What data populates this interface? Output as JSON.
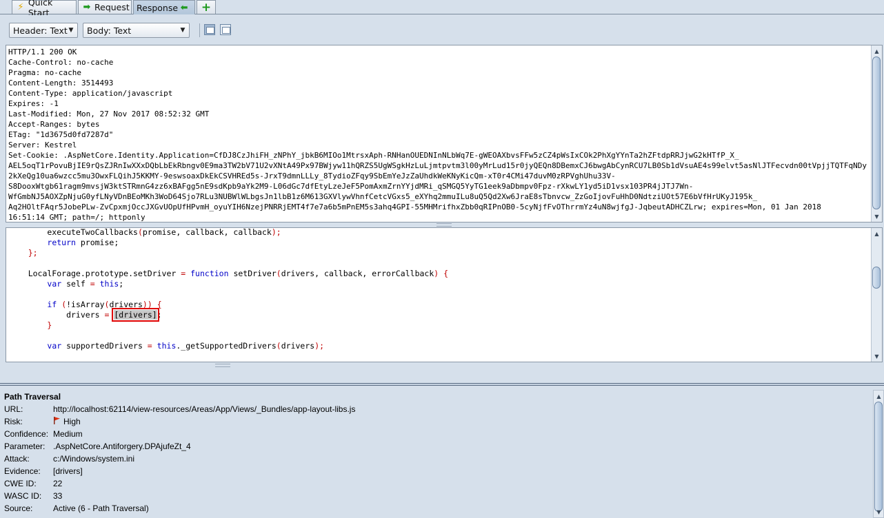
{
  "tabs": [
    {
      "label": "Quick Start",
      "icon": "lightning-icon"
    },
    {
      "label": "Request",
      "icon": "arrow-right-icon"
    },
    {
      "label": "Response",
      "icon": "arrow-left-icon"
    },
    {
      "label": "",
      "icon": "plus-icon"
    }
  ],
  "toolbar": {
    "header_view": "Header: Text",
    "body_view": "Body: Text"
  },
  "header_text": "HTTP/1.1 200 OK\nCache-Control: no-cache\nPragma: no-cache\nContent-Length: 3514493\nContent-Type: application/javascript\nExpires: -1\nLast-Modified: Mon, 27 Nov 2017 08:52:32 GMT\nAccept-Ranges: bytes\nETag: \"1d3675d0fd7287d\"\nServer: Kestrel\nSet-Cookie: .AspNetCore.Identity.Application=CfDJ8CzJhiFH_zNPhY_jbkB6MIOo1MtrsxAph-RNHanOUEDNInNLbWq7E-gWEOAXbvsFFw5zCZ4pWsIxCOk2PhXgYYnTa2hZFtdpRRJjwG2kHTfP_X_\nAEL5oqT1rPovuBjIE9rQsZJRnIwXXxDQbLbEkRbngv0E9ma3TW2bV71U2vXNtA49Px97BWjyw11hQRZS5UgWSgkHzLuLjmtpvtm3l00yMrLud15r0jyQEQn8DBemxCJ6bwgAbCynRCU7LB0Sb1dVsuAE4s99elvt5asNlJTFecvdn00tVpjjTQTFqNDy2kXeQg10ua6wzcc5mu3OwxFLQihJ5KKMY-9eswsoaxDkEkCSVHREd5s-JrxT9dmnLLLy_8TydioZFqy9SbEmYeJzZaUhdkWeKNyKicQm-xT0r4CMi47duvM0zRPVghUhu33V-\nS8DooxWtgb61ragm9mvsjW3ktSTRmnG4zz6xBAFgg5nE9sdKpb9aYk2M9-L06dGc7dfEtyLzeJeF5PomAxmZrnYYjdMRi_qSMGQ5YyTG1eek9aDbmpv0Fpz-rXkwLY1yd5iD1vsx103PR4jJTJ7Wn-\nWfGmbNJ5AOXZpNjuG0yfLNyVDnBEoMKh3WoD64Sjo7RLu3NUBWlWLbgsJn1lbB1z6M613GXVlywVhnfCetcVGxs5_eXYhq2mmuILu8uQ5Qd2Xw6JraE8sTbnvcw_ZzGoIjovFuHhD0NdtziUOt57E6bVfHrUKyJ195k_\nAq2HOltFAqr5JobePLw-ZvCpxmjOccJXGvUOpUfHPvmH_oyuYIH6NzejPNRRjEMT4f7e7a6b5mPnEM5s3ahq4GPI-55MHMrifhxZbb0qRIPnOB0-5cyNjfFvOThrrmYz4uN8wjfgJ-JqbeutADHCZLrw; expires=Mon, 01 Jan 2018\n16:51:14 GMT; path=/; httponly",
  "code_lines": [
    {
      "segments": [
        {
          "t": "        executeTwoCallbacks",
          "c": ""
        },
        {
          "t": "(",
          "c": "pn"
        },
        {
          "t": "promise, callback, callback",
          "c": ""
        },
        {
          "t": ");",
          "c": "pn"
        }
      ]
    },
    {
      "segments": [
        {
          "t": "        ",
          "c": ""
        },
        {
          "t": "return",
          "c": "kw"
        },
        {
          "t": " promise;",
          "c": ""
        }
      ]
    },
    {
      "segments": [
        {
          "t": "    ",
          "c": ""
        },
        {
          "t": "};",
          "c": "pn"
        }
      ]
    },
    {
      "segments": [
        {
          "t": "",
          "c": ""
        }
      ]
    },
    {
      "segments": [
        {
          "t": "    LocalForage.prototype.setDriver ",
          "c": ""
        },
        {
          "t": "=",
          "c": "pn"
        },
        {
          "t": " ",
          "c": ""
        },
        {
          "t": "function",
          "c": "kw"
        },
        {
          "t": " setDriver",
          "c": ""
        },
        {
          "t": "(",
          "c": "pn"
        },
        {
          "t": "drivers, callback, errorCallback",
          "c": ""
        },
        {
          "t": ")",
          "c": "pn"
        },
        {
          "t": " ",
          "c": ""
        },
        {
          "t": "{",
          "c": "pn"
        }
      ]
    },
    {
      "segments": [
        {
          "t": "        ",
          "c": ""
        },
        {
          "t": "var",
          "c": "kw"
        },
        {
          "t": " self ",
          "c": ""
        },
        {
          "t": "=",
          "c": "pn"
        },
        {
          "t": " ",
          "c": ""
        },
        {
          "t": "this",
          "c": "kw"
        },
        {
          "t": ";",
          "c": ""
        }
      ]
    },
    {
      "segments": [
        {
          "t": "",
          "c": ""
        }
      ]
    },
    {
      "segments": [
        {
          "t": "        ",
          "c": ""
        },
        {
          "t": "if",
          "c": "kw"
        },
        {
          "t": " ",
          "c": ""
        },
        {
          "t": "(",
          "c": "pn"
        },
        {
          "t": "!isArray",
          "c": ""
        },
        {
          "t": "(",
          "c": "pn"
        },
        {
          "t": "drivers",
          "c": ""
        },
        {
          "t": "))",
          "c": "pn"
        },
        {
          "t": " ",
          "c": ""
        },
        {
          "t": "{",
          "c": "pn"
        }
      ]
    },
    {
      "segments": [
        {
          "t": "            drivers ",
          "c": ""
        },
        {
          "t": "=",
          "c": "pn"
        },
        {
          "t": " ",
          "c": ""
        },
        {
          "t": "[drivers]",
          "c": "hl"
        },
        {
          "t": ";",
          "c": ""
        }
      ]
    },
    {
      "segments": [
        {
          "t": "        ",
          "c": ""
        },
        {
          "t": "}",
          "c": "pn"
        }
      ]
    },
    {
      "segments": [
        {
          "t": "",
          "c": ""
        }
      ]
    },
    {
      "segments": [
        {
          "t": "        ",
          "c": ""
        },
        {
          "t": "var",
          "c": "kw"
        },
        {
          "t": " supportedDrivers ",
          "c": ""
        },
        {
          "t": "=",
          "c": "pn"
        },
        {
          "t": " ",
          "c": ""
        },
        {
          "t": "this",
          "c": "kw"
        },
        {
          "t": "._getSupportedDrivers",
          "c": ""
        },
        {
          "t": "(",
          "c": "pn"
        },
        {
          "t": "drivers",
          "c": ""
        },
        {
          "t": ");",
          "c": "pn"
        }
      ]
    }
  ],
  "alert": {
    "title": "Path Traversal",
    "rows": [
      {
        "label": "URL:",
        "value": "http://localhost:62114/view-resources/Areas/App/Views/_Bundles/app-layout-libs.js"
      },
      {
        "label": "Risk:",
        "value": "High",
        "icon": "red-flag-icon"
      },
      {
        "label": "Confidence:",
        "value": "Medium"
      },
      {
        "label": "Parameter:",
        "value": ".AspNetCore.Antiforgery.DPAjufeZt_4"
      },
      {
        "label": "Attack:",
        "value": "c:/Windows/system.ini"
      },
      {
        "label": "Evidence:",
        "value": "[drivers]"
      },
      {
        "label": "CWE ID:",
        "value": "22"
      },
      {
        "label": "WASC ID:",
        "value": "33"
      },
      {
        "label": "Source:",
        "value": "Active (6 - Path Traversal)"
      }
    ]
  },
  "colors": {
    "background": "#d6e0eb",
    "keyword": "#0000c8",
    "punctuation": "#c00000",
    "evidence_highlight": "#e00000"
  }
}
